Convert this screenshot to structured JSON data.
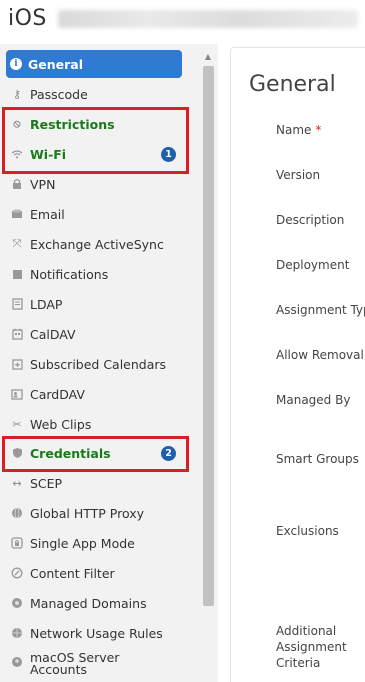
{
  "header": {
    "platform": "iOS"
  },
  "sidebar": {
    "items": [
      {
        "label": "General",
        "icon": "info-icon"
      },
      {
        "label": "Passcode",
        "icon": "key-icon"
      },
      {
        "label": "Restrictions",
        "icon": "ban-icon"
      },
      {
        "label": "Wi-Fi",
        "icon": "wifi-icon",
        "badge": "1"
      },
      {
        "label": "VPN",
        "icon": "lock-icon"
      },
      {
        "label": "Email",
        "icon": "email-icon"
      },
      {
        "label": "Exchange ActiveSync",
        "icon": "sync-icon"
      },
      {
        "label": "Notifications",
        "icon": "notification-icon"
      },
      {
        "label": "LDAP",
        "icon": "ldap-icon"
      },
      {
        "label": "CalDAV",
        "icon": "calendar-icon"
      },
      {
        "label": "Subscribed Calendars",
        "icon": "calendar-plus-icon"
      },
      {
        "label": "CardDAV",
        "icon": "contact-card-icon"
      },
      {
        "label": "Web Clips",
        "icon": "scissors-icon"
      },
      {
        "label": "Credentials",
        "icon": "shield-icon",
        "badge": "2"
      },
      {
        "label": "SCEP",
        "icon": "arrows-icon"
      },
      {
        "label": "Global HTTP Proxy",
        "icon": "globe-icon"
      },
      {
        "label": "Single App Mode",
        "icon": "app-lock-icon"
      },
      {
        "label": "Content Filter",
        "icon": "filter-icon"
      },
      {
        "label": "Managed Domains",
        "icon": "domain-icon"
      },
      {
        "label": "Network Usage Rules",
        "icon": "network-icon"
      },
      {
        "label": "macOS Server Accounts",
        "icon": "server-icon"
      }
    ]
  },
  "main": {
    "title": "General",
    "fields": {
      "name": "Name",
      "name_required": "*",
      "version": "Version",
      "description": "Description",
      "deployment": "Deployment",
      "assignment_type": "Assignment Type",
      "allow_removal": "Allow Removal",
      "managed_by": "Managed By",
      "smart_groups": "Smart Groups",
      "exclusions": "Exclusions",
      "additional_criteria": "Additional Assignment Criteria"
    }
  },
  "colors": {
    "active": "#2f7bd3",
    "highlight": "#d81f26",
    "badge": "#1f5fae",
    "green_text": "#1a7a1a"
  }
}
